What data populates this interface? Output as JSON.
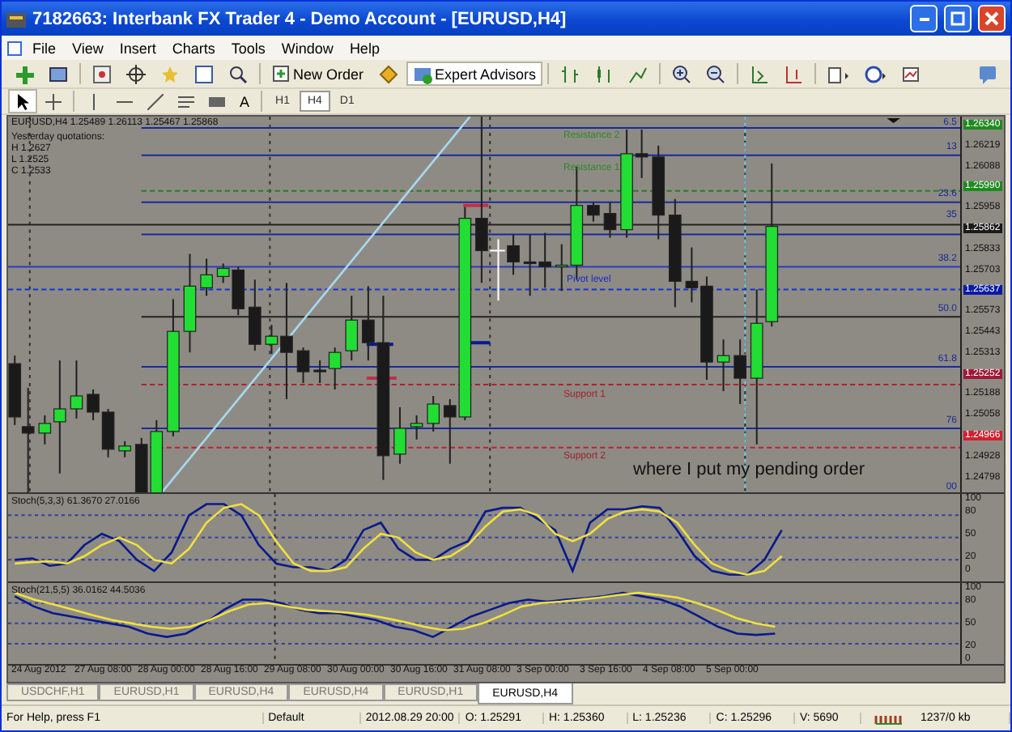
{
  "window": {
    "title": "7182663: Interbank FX Trader 4 - Demo Account - [EURUSD,H4]"
  },
  "menu": [
    "File",
    "View",
    "Insert",
    "Charts",
    "Tools",
    "Window",
    "Help"
  ],
  "toolbar": {
    "new_order": "New Order",
    "expert_advisors": "Expert Advisors"
  },
  "drawing_toolbar": {
    "text_tool": "A",
    "timeframes": [
      {
        "label": "H1",
        "selected": false
      },
      {
        "label": "H4",
        "selected": true
      },
      {
        "label": "D1",
        "selected": false
      }
    ]
  },
  "chart": {
    "header": "EURUSD,H4  1.25489 1.26113 1.25467 1.25868",
    "yesterday": [
      "Yesterday quotations:",
      "H 1.2627",
      "L 1.2525",
      "C 1.2533"
    ],
    "level_labels": [
      {
        "text": "Resistance 2",
        "kind": "resistance"
      },
      {
        "text": "Resistance 1",
        "kind": "resistance"
      },
      {
        "text": "Pivot level",
        "kind": "pivot"
      },
      {
        "text": "Support 1",
        "kind": "support"
      },
      {
        "text": "Support 2",
        "kind": "support"
      }
    ],
    "fib_labels": [
      "6.5",
      "13",
      "23.6",
      "35",
      "38.2",
      "50.0",
      "61.8",
      "76",
      "00"
    ],
    "annotation": "where I put my pending order",
    "price_axis": [
      {
        "text": "1.26340",
        "color": "#1e8a1e"
      },
      {
        "text": "1.26219"
      },
      {
        "text": "1.26088"
      },
      {
        "text": "1.25990",
        "color": "#1e8a1e"
      },
      {
        "text": "1.25958"
      },
      {
        "text": "1.25862",
        "color": "#1a1a1a"
      },
      {
        "text": "1.25833"
      },
      {
        "text": "1.25703"
      },
      {
        "text": "1.25637",
        "color": "#0a1aa8"
      },
      {
        "text": "1.25573"
      },
      {
        "text": "1.25443"
      },
      {
        "text": "1.25313"
      },
      {
        "text": "1.25252",
        "color": "#a01838"
      },
      {
        "text": "1.25188"
      },
      {
        "text": "1.25058"
      },
      {
        "text": "1.24966",
        "color": "#d02030"
      },
      {
        "text": "1.24928"
      },
      {
        "text": "1.24798"
      }
    ]
  },
  "oscillators": [
    {
      "label": "Stoch(5,3,3) 61.3670 27.0166",
      "axis": [
        "100",
        "80",
        "50",
        "20",
        "0"
      ]
    },
    {
      "label": "Stoch(21,5,5) 36.0162 44.5036",
      "axis": [
        "100",
        "80",
        "50",
        "20",
        "0"
      ]
    }
  ],
  "time_axis": [
    "24 Aug 2012",
    "27 Aug 08:00",
    "28 Aug 00:00",
    "28 Aug 16:00",
    "29 Aug 08:00",
    "30 Aug 00:00",
    "30 Aug 16:00",
    "31 Aug 08:00",
    "3 Sep 00:00",
    "3 Sep 16:00",
    "4 Sep 08:00",
    "5 Sep 00:00"
  ],
  "tabs": [
    {
      "label": "USDCHF,H1",
      "selected": false
    },
    {
      "label": "EURUSD,H1",
      "selected": false
    },
    {
      "label": "EURUSD,H4",
      "selected": false
    },
    {
      "label": "EURUSD,H4",
      "selected": false
    },
    {
      "label": "EURUSD,H1",
      "selected": false
    },
    {
      "label": "EURUSD,H4",
      "selected": true
    }
  ],
  "status_bar": [
    "For Help, press F1",
    "Default",
    "2012.08.29 20:00",
    "O: 1.25291",
    "H: 1.25360",
    "L: 1.25236",
    "C: 1.25296",
    "V: 5690",
    "1237/0 kb"
  ]
}
